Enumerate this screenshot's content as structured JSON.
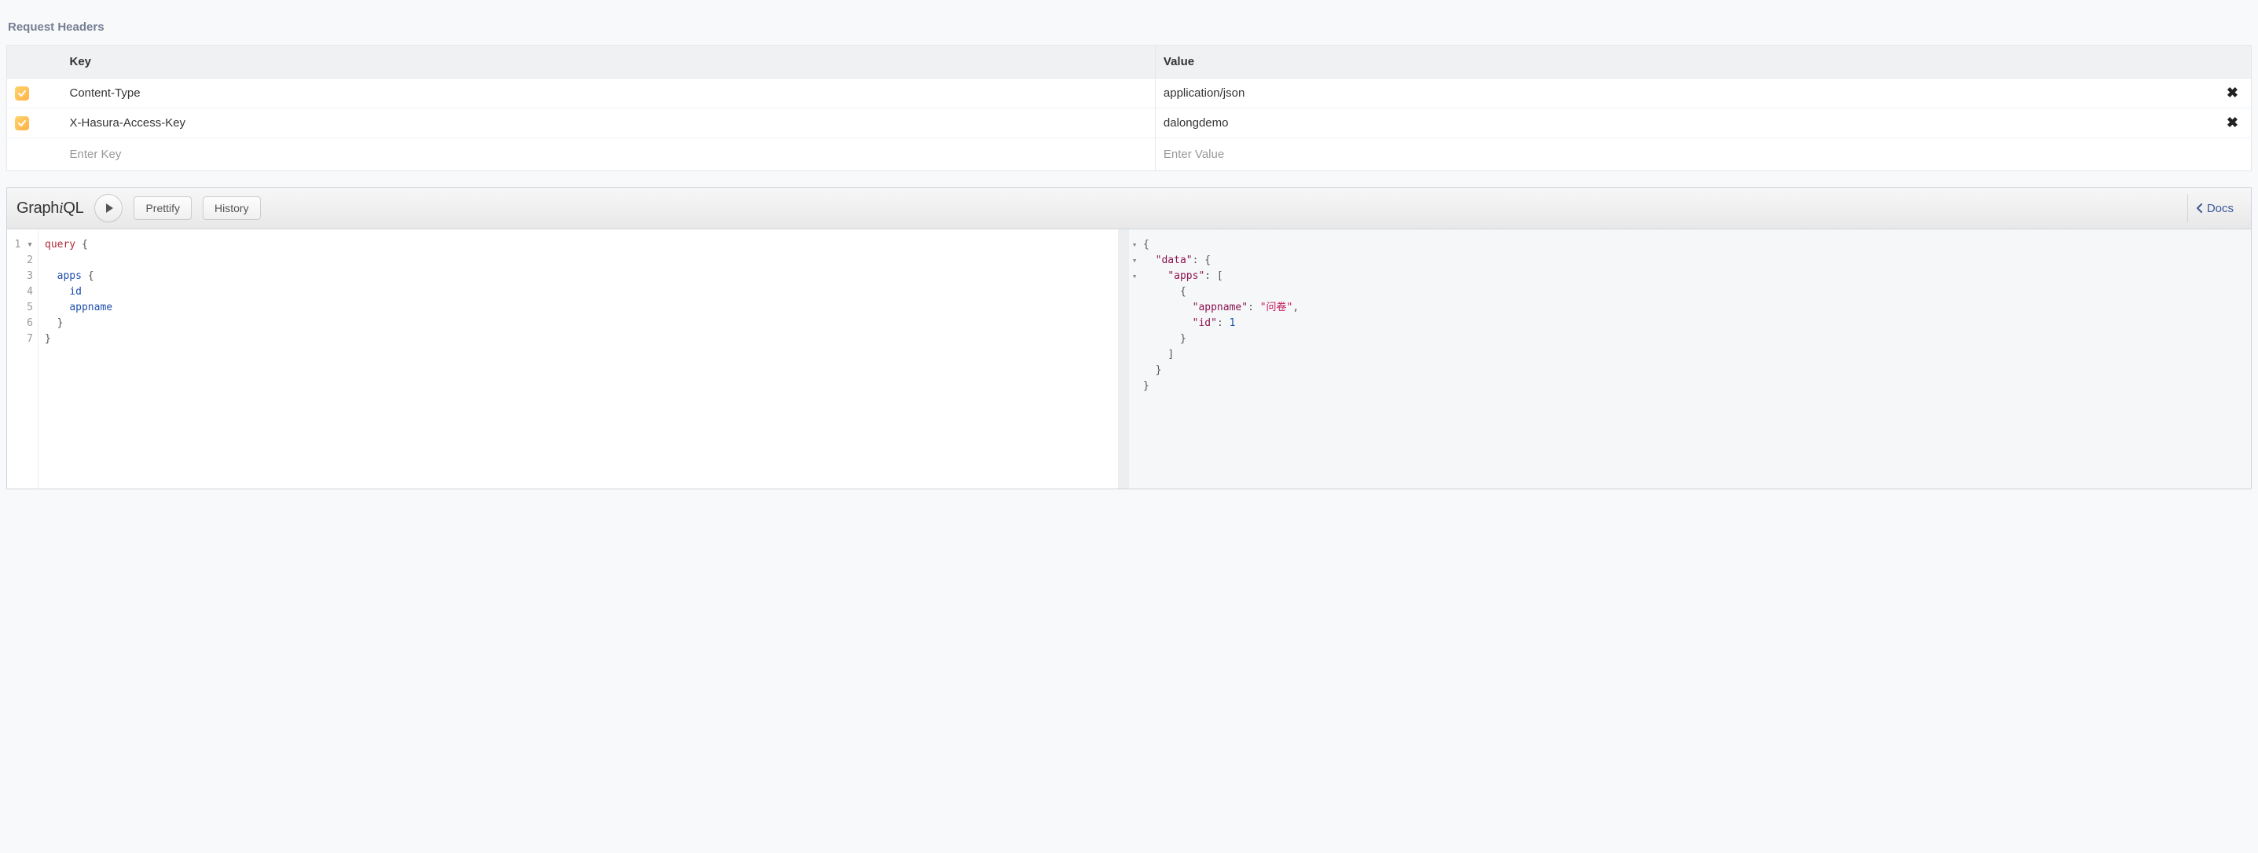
{
  "section_title": "Request Headers",
  "headers": {
    "col_key": "Key",
    "col_value": "Value",
    "rows": [
      {
        "checked": true,
        "key": "Content-Type",
        "value": "application/json"
      },
      {
        "checked": true,
        "key": "X-Hasura-Access-Key",
        "value": "dalongdemo"
      }
    ],
    "key_placeholder": "Enter Key",
    "value_placeholder": "Enter Value"
  },
  "graphiql": {
    "logo_prefix": "Graph",
    "logo_i": "i",
    "logo_suffix": "QL",
    "prettify": "Prettify",
    "history": "History",
    "docs": "Docs"
  },
  "query": {
    "line_numbers": [
      "1",
      "2",
      "3",
      "4",
      "5",
      "6",
      "7"
    ],
    "tokens": {
      "query_kw": "query",
      "apps": "apps",
      "id": "id",
      "appname": "appname"
    }
  },
  "result": {
    "data_key": "\"data\"",
    "apps_key": "\"apps\"",
    "appname_key": "\"appname\"",
    "appname_val": "\"问卷\"",
    "id_key": "\"id\"",
    "id_val": "1"
  }
}
